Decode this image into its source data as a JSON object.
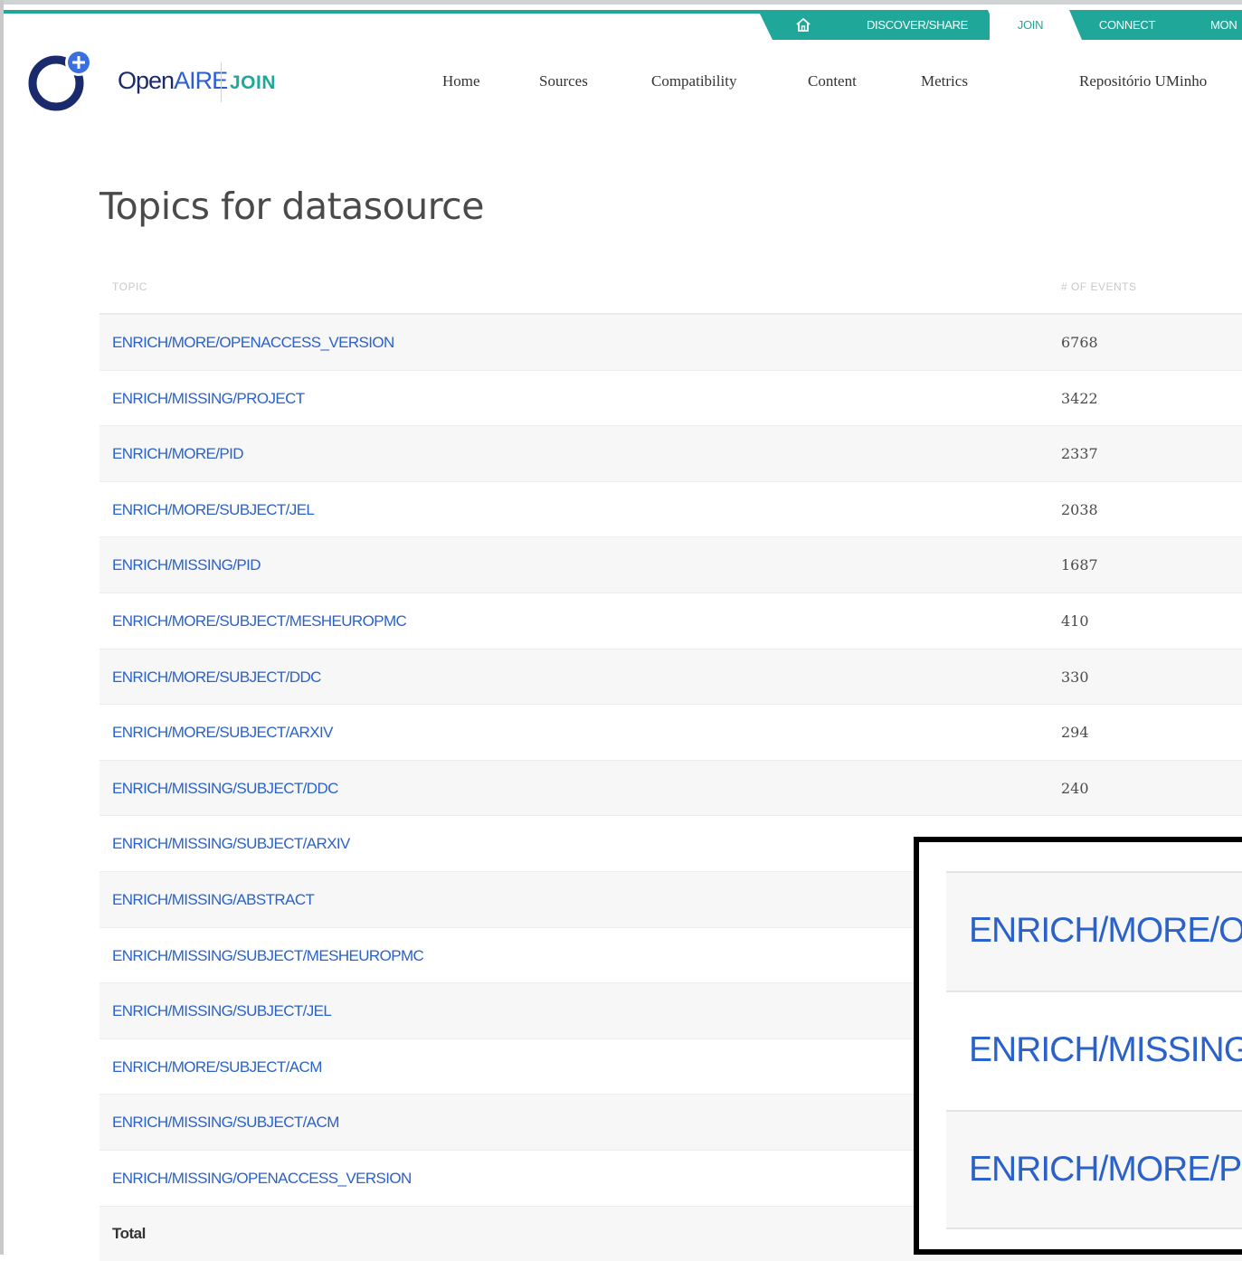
{
  "topnav": {
    "home_icon": "home-icon",
    "items": [
      {
        "label": "DISCOVER/SHARE"
      },
      {
        "label": "JOIN",
        "active": true
      },
      {
        "label": "CONNECT"
      },
      {
        "label": "MON"
      }
    ]
  },
  "logo": {
    "open": "Open",
    "aire": "AIRE",
    "join": "JOIN"
  },
  "mainnav": {
    "items": [
      {
        "label": "Home"
      },
      {
        "label": "Sources"
      },
      {
        "label": "Compatibility"
      },
      {
        "label": "Content"
      },
      {
        "label": "Metrics"
      },
      {
        "label": "Repositório UMinho"
      }
    ]
  },
  "page": {
    "title": "Topics for datasource"
  },
  "table": {
    "headers": {
      "topic": "TOPIC",
      "events": "# OF EVENTS"
    },
    "rows": [
      {
        "topic": "ENRICH/MORE/OPENACCESS_VERSION",
        "count": "6768"
      },
      {
        "topic": "ENRICH/MISSING/PROJECT",
        "count": "3422"
      },
      {
        "topic": "ENRICH/MORE/PID",
        "count": "2337"
      },
      {
        "topic": "ENRICH/MORE/SUBJECT/JEL",
        "count": "2038"
      },
      {
        "topic": "ENRICH/MISSING/PID",
        "count": "1687"
      },
      {
        "topic": "ENRICH/MORE/SUBJECT/MESHEUROPMC",
        "count": "410"
      },
      {
        "topic": "ENRICH/MORE/SUBJECT/DDC",
        "count": "330"
      },
      {
        "topic": "ENRICH/MORE/SUBJECT/ARXIV",
        "count": "294"
      },
      {
        "topic": "ENRICH/MISSING/SUBJECT/DDC",
        "count": "240"
      },
      {
        "topic": "ENRICH/MISSING/SUBJECT/ARXIV",
        "count": ""
      },
      {
        "topic": "ENRICH/MISSING/ABSTRACT",
        "count": ""
      },
      {
        "topic": "ENRICH/MISSING/SUBJECT/MESHEUROPMC",
        "count": ""
      },
      {
        "topic": "ENRICH/MISSING/SUBJECT/JEL",
        "count": ""
      },
      {
        "topic": "ENRICH/MORE/SUBJECT/ACM",
        "count": ""
      },
      {
        "topic": "ENRICH/MISSING/SUBJECT/ACM",
        "count": ""
      },
      {
        "topic": "ENRICH/MISSING/OPENACCESS_VERSION",
        "count": ""
      }
    ],
    "total_label": "Total"
  },
  "zoom": {
    "items": [
      {
        "text": "ENRICH/MORE/O"
      },
      {
        "text": "ENRICH/MISSING/"
      },
      {
        "text": "ENRICH/MORE/PI"
      }
    ]
  },
  "colors": {
    "teal": "#1fa89a",
    "link_blue": "#2b62c9",
    "logo_navy": "#1a2a6c"
  }
}
